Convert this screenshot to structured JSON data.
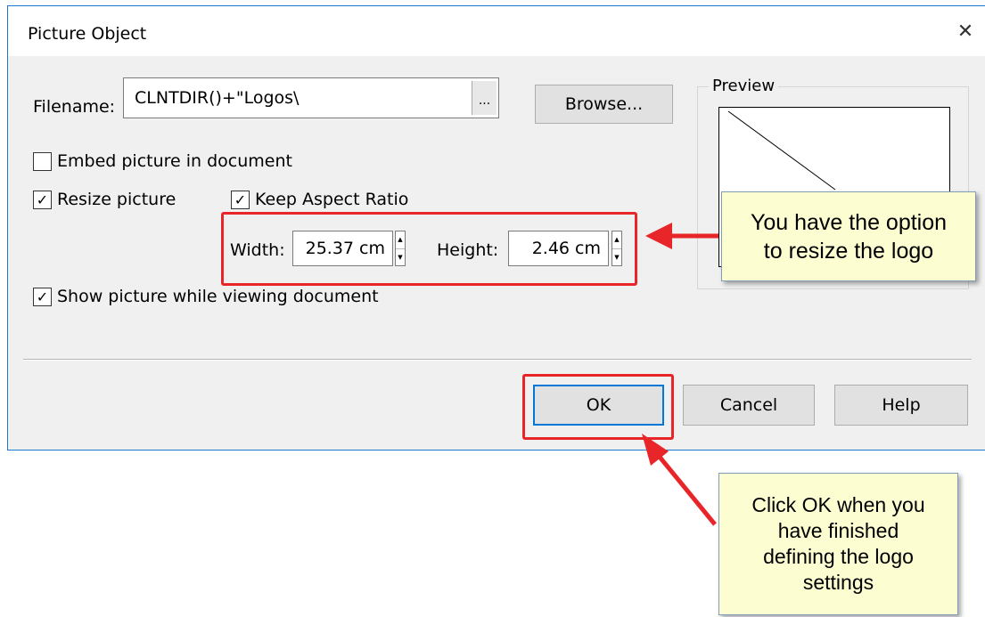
{
  "dialog": {
    "title": "Picture Object",
    "close_glyph": "✕",
    "filename_label": "Filename:",
    "filename_value": "CLNTDIR()+\"Logos\\",
    "dots_label": "...",
    "browse_label": "Browse...",
    "embed_label": "Embed picture in document",
    "embed_checked": false,
    "resize_label": "Resize picture",
    "resize_checked": true,
    "aspect_label": "Keep Aspect Ratio",
    "aspect_checked": true,
    "width_label": "Width:",
    "width_value": "25.37 cm",
    "height_label": "Height:",
    "height_value": "2.46 cm",
    "show_label": "Show picture while viewing document",
    "show_checked": true,
    "preview_label": "Preview",
    "ok_label": "OK",
    "cancel_label": "Cancel",
    "help_label": "Help",
    "check_glyph": "✓",
    "spin_up": "▲",
    "spin_down": "▼"
  },
  "callouts": {
    "resize_line1": "You have the option",
    "resize_line2": "to resize the logo",
    "ok_line1": "Click OK when you",
    "ok_line2": "have finished",
    "ok_line3": "defining the logo",
    "ok_line4": "settings"
  },
  "colors": {
    "highlight": "#e8262a",
    "callout_bg": "#fdfdd2",
    "dialog_bg": "#f0f0f0",
    "accent": "#1e78c8"
  }
}
